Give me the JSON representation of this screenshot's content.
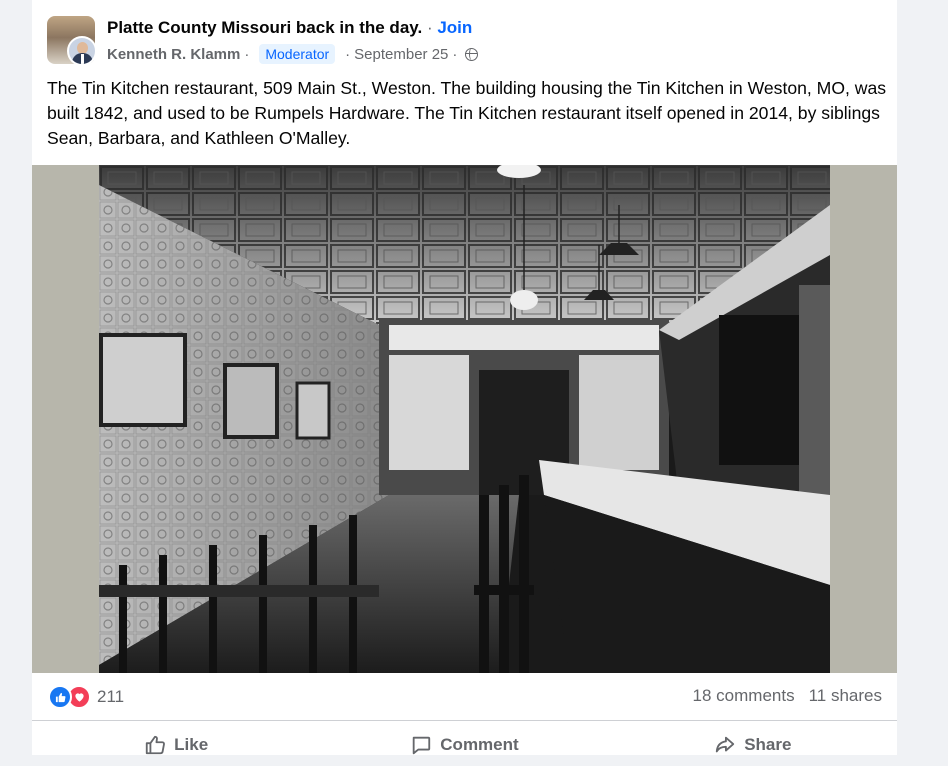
{
  "post": {
    "group_name": "Platte County Missouri back in the day.",
    "join_dot": "·",
    "join_label": "Join",
    "author": "Kenneth R. Klamm",
    "role_badge": "Moderator",
    "date": "September 25",
    "meta_sep": "·",
    "text": "The Tin Kitchen restaurant, 509 Main St., Weston. The building housing the Tin Kitchen in Weston, MO, was built 1842, and used to be Rumpels Hardware.  The Tin Kitchen restaurant itself opened in 2014, by siblings Sean, Barbara, and Kathleen O'Malley."
  },
  "engagement": {
    "reaction_count": "211",
    "comments": "18 comments",
    "shares": "11 shares"
  },
  "actions": {
    "like": "Like",
    "comment": "Comment",
    "share": "Share"
  },
  "icons": [
    "group-avatar",
    "user-avatar",
    "globe-icon",
    "like-reaction-icon",
    "love-reaction-icon",
    "thumbs-up-icon",
    "comment-bubble-icon",
    "share-arrow-icon"
  ],
  "colors": {
    "accent": "#0866ff",
    "like_reaction": "#1877f2",
    "love_reaction": "#f33e58",
    "secondary_text": "#65676b",
    "photo_background": "#b7b6ab"
  }
}
